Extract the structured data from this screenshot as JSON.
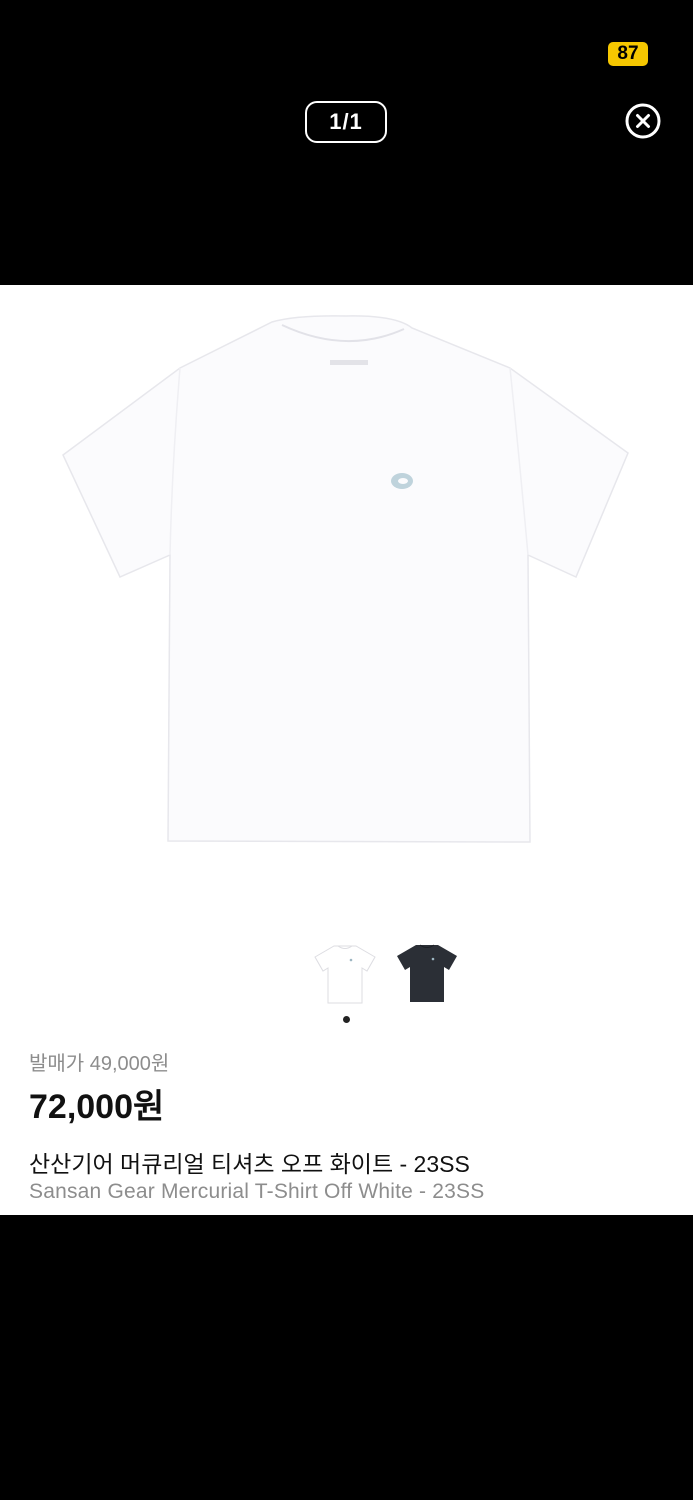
{
  "status": {
    "battery": "87"
  },
  "viewer": {
    "counter": "1/1",
    "close_icon": "close-circle-icon"
  },
  "product": {
    "release_price": "발매가 49,000원",
    "price": "72,000원",
    "name_ko": "산산기어 머큐리얼 티셔츠 오프 화이트 - 23SS",
    "name_en": "Sansan Gear Mercurial T-Shirt Off White - 23SS"
  },
  "colors": {
    "battery_badge": "#f6c700",
    "tshirt_white": "#ffffff",
    "tshirt_dark": "#2b2f36"
  }
}
